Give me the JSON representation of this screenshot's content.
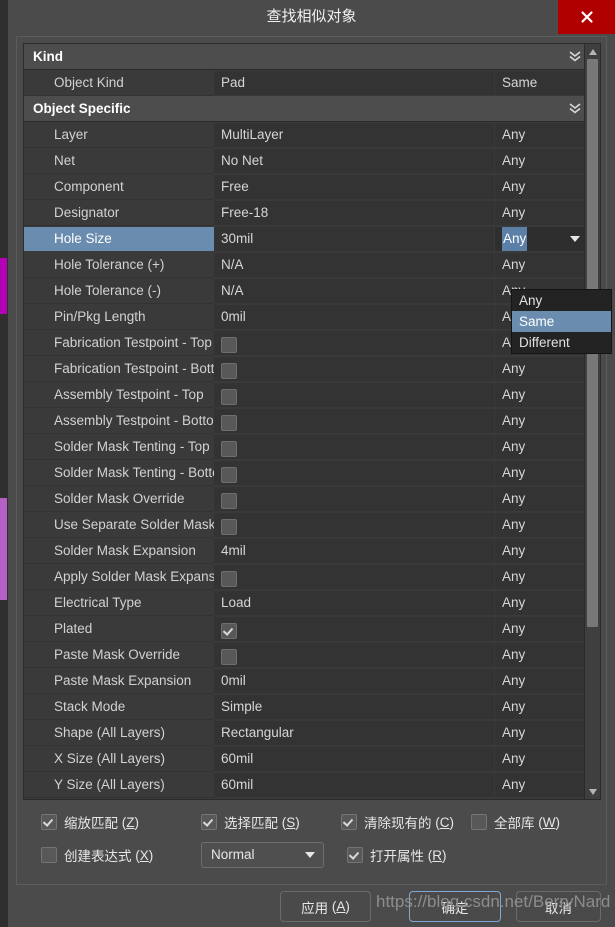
{
  "window": {
    "title": "查找相似对象",
    "close_icon": "close-icon"
  },
  "grid": {
    "groups": [
      {
        "label": "Kind",
        "chevron": "chevron-double-down-icon"
      },
      {
        "label": "Object Specific",
        "chevron": "chevron-double-down-icon"
      }
    ],
    "rows": [
      {
        "type": "group",
        "gi": 0
      },
      {
        "type": "data",
        "name": "Object Kind",
        "value": "Pad",
        "kind": "text",
        "mode": "Same"
      },
      {
        "type": "group",
        "gi": 1
      },
      {
        "type": "data",
        "name": "Layer",
        "value": "MultiLayer",
        "kind": "text",
        "mode": "Any"
      },
      {
        "type": "data",
        "name": "Net",
        "value": "No Net",
        "kind": "text",
        "mode": "Any"
      },
      {
        "type": "data",
        "name": "Component",
        "value": "Free",
        "kind": "text",
        "mode": "Any"
      },
      {
        "type": "data",
        "name": "Designator",
        "value": "Free-18",
        "kind": "text",
        "mode": "Any"
      },
      {
        "type": "data",
        "name": "Hole Size",
        "value": "30mil",
        "kind": "text",
        "mode": "Any",
        "selected": true,
        "editing": true
      },
      {
        "type": "data",
        "name": "Hole Tolerance (+)",
        "value": "N/A",
        "kind": "text",
        "mode": "Any"
      },
      {
        "type": "data",
        "name": "Hole Tolerance (-)",
        "value": "N/A",
        "kind": "text",
        "mode": "Any"
      },
      {
        "type": "data",
        "name": "Pin/Pkg Length",
        "value": "0mil",
        "kind": "text",
        "mode": "Any"
      },
      {
        "type": "data",
        "name": "Fabrication Testpoint - Top",
        "value": "",
        "kind": "check",
        "checked": false,
        "mode": "Any"
      },
      {
        "type": "data",
        "name": "Fabrication Testpoint - Bottom",
        "value": "",
        "kind": "check",
        "checked": false,
        "mode": "Any"
      },
      {
        "type": "data",
        "name": "Assembly Testpoint - Top",
        "value": "",
        "kind": "check",
        "checked": false,
        "mode": "Any"
      },
      {
        "type": "data",
        "name": "Assembly Testpoint - Bottom",
        "value": "",
        "kind": "check",
        "checked": false,
        "mode": "Any"
      },
      {
        "type": "data",
        "name": "Solder Mask Tenting - Top",
        "value": "",
        "kind": "check",
        "checked": false,
        "mode": "Any"
      },
      {
        "type": "data",
        "name": "Solder Mask Tenting - Bottom",
        "value": "",
        "kind": "check",
        "checked": false,
        "mode": "Any"
      },
      {
        "type": "data",
        "name": "Solder Mask Override",
        "value": "",
        "kind": "check",
        "checked": false,
        "mode": "Any"
      },
      {
        "type": "data",
        "name": "Use Separate Solder Mask",
        "value": "",
        "kind": "check",
        "checked": false,
        "mode": "Any"
      },
      {
        "type": "data",
        "name": "Solder Mask Expansion",
        "value": "4mil",
        "kind": "text",
        "mode": "Any"
      },
      {
        "type": "data",
        "name": "Apply Solder Mask Expansion",
        "value": "",
        "kind": "check",
        "checked": false,
        "mode": "Any"
      },
      {
        "type": "data",
        "name": "Electrical Type",
        "value": "Load",
        "kind": "text",
        "mode": "Any"
      },
      {
        "type": "data",
        "name": "Plated",
        "value": "",
        "kind": "check",
        "checked": true,
        "mode": "Any"
      },
      {
        "type": "data",
        "name": "Paste Mask Override",
        "value": "",
        "kind": "check",
        "checked": false,
        "mode": "Any"
      },
      {
        "type": "data",
        "name": "Paste Mask Expansion",
        "value": "0mil",
        "kind": "text",
        "mode": "Any"
      },
      {
        "type": "data",
        "name": "Stack Mode",
        "value": "Simple",
        "kind": "text",
        "mode": "Any"
      },
      {
        "type": "data",
        "name": "Shape (All Layers)",
        "value": "Rectangular",
        "kind": "text",
        "mode": "Any"
      },
      {
        "type": "data",
        "name": "X Size (All Layers)",
        "value": "60mil",
        "kind": "text",
        "mode": "Any"
      },
      {
        "type": "data",
        "name": "Y Size (All Layers)",
        "value": "60mil",
        "kind": "text",
        "mode": "Any"
      }
    ],
    "scrollbar": {
      "up_icon": "triangle-up-icon",
      "down_icon": "triangle-down-icon"
    }
  },
  "dropdown": {
    "open": true,
    "caret_icon": "caret-down-icon",
    "options": [
      {
        "label": "Any",
        "highlighted": false
      },
      {
        "label": "Same",
        "highlighted": true
      },
      {
        "label": "Different",
        "highlighted": false
      }
    ]
  },
  "options": {
    "zoom_match": {
      "label": "缩放匹配",
      "accel": "Z",
      "checked": true
    },
    "select_match": {
      "label": "选择匹配",
      "accel": "S",
      "checked": true
    },
    "clear_existing": {
      "label": "清除现有的",
      "accel": "C",
      "checked": true
    },
    "all_library": {
      "label": "全部库",
      "accel": "W",
      "checked": false
    },
    "create_expression": {
      "label": "创建表达式",
      "accel": "X",
      "checked": false
    },
    "open_properties": {
      "label": "打开属性",
      "accel": "R",
      "checked": true
    },
    "mode_combo": {
      "value": "Normal",
      "caret_icon": "caret-down-icon"
    }
  },
  "footer": {
    "apply": {
      "label": "应用",
      "accel": "A"
    },
    "ok": {
      "label": "确定",
      "accel": ""
    },
    "cancel": {
      "label": "取消",
      "accel": ""
    }
  },
  "watermark": "https://blog.csdn.net/BerryNard",
  "colors": {
    "dialog_bg": "#4b4b4b",
    "grid_bg": "#3a3a3a",
    "cell_bg": "#333333",
    "selection": "#6a8cae",
    "close_red": "#b00000",
    "accent_border": "#7fa8d0",
    "strip_magenta": "#b400b4",
    "strip_violet": "#b560c4"
  }
}
